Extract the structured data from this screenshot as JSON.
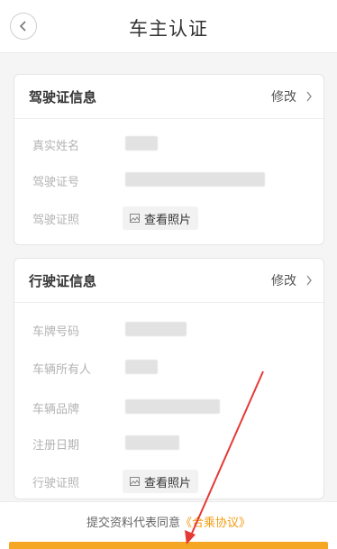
{
  "header": {
    "title": "车主认证"
  },
  "license": {
    "title": "驾驶证信息",
    "edit_label": "修改",
    "rows": [
      {
        "label": "真实姓名"
      },
      {
        "label": "驾驶证号"
      },
      {
        "label": "驾驶证照",
        "button": "查看照片"
      }
    ]
  },
  "vehicle": {
    "title": "行驶证信息",
    "edit_label": "修改",
    "rows": [
      {
        "label": "车牌号码"
      },
      {
        "label": "车辆所有人"
      },
      {
        "label": "车辆品牌"
      },
      {
        "label": "注册日期"
      },
      {
        "label": "行驶证照",
        "button": "查看照片"
      }
    ]
  },
  "footer": {
    "agree_text": "提交资料代表同意",
    "agree_link": "《合乘协议》"
  },
  "colors": {
    "accent": "#f5a623",
    "annotation": "#e53935"
  }
}
